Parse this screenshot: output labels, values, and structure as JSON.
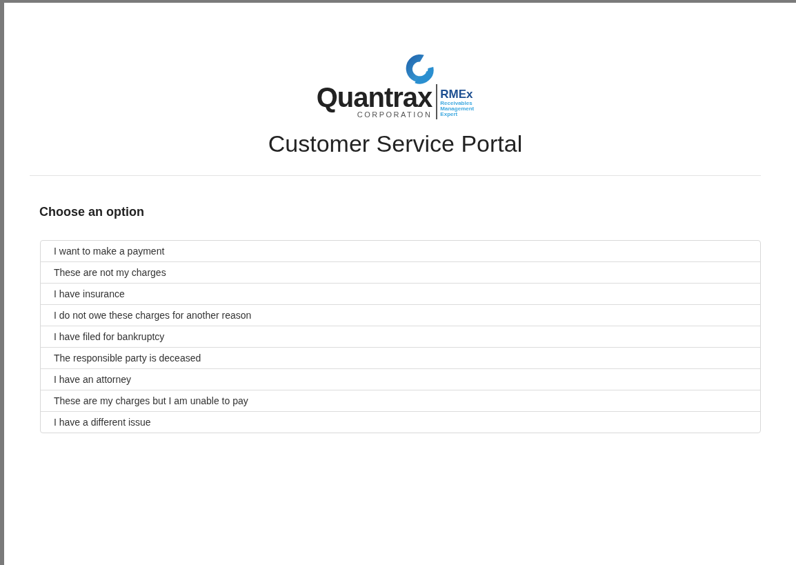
{
  "logo": {
    "name": "Quantrax",
    "subtitle": "CORPORATION",
    "product": "RMEx",
    "product_lines": [
      "Receivables",
      "Management",
      "Expert"
    ]
  },
  "title": "Customer Service Portal",
  "prompt": "Choose an option",
  "options": [
    {
      "label": "I want to make a payment"
    },
    {
      "label": "These are not my charges"
    },
    {
      "label": "I have insurance"
    },
    {
      "label": "I do not owe these charges for another reason"
    },
    {
      "label": "I have filed for bankruptcy"
    },
    {
      "label": "The responsible party is deceased"
    },
    {
      "label": "I have an attorney"
    },
    {
      "label": "These are my charges but I am unable to pay"
    },
    {
      "label": "I have a different issue"
    }
  ]
}
